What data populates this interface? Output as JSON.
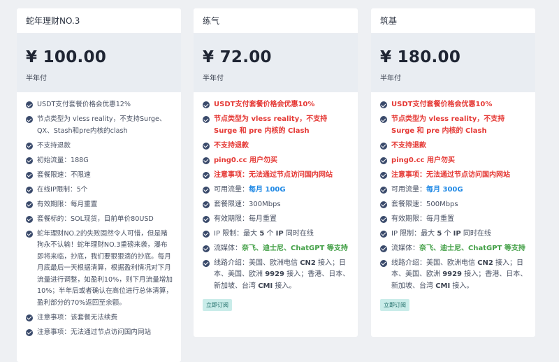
{
  "plans": [
    {
      "name": "蛇年理财NO.3",
      "price": "¥ 100.00",
      "period": "半年付",
      "features": [
        "USDT支付套餐价格会优惠12%",
        "节点类型为 vless reality，不支持Surge、QX、Stash和pre内核的clash",
        "不支持退款",
        "初始流量：188G",
        "套餐限速：不限速",
        "在线IP限制：5个",
        "有效期限：每月重置",
        "套餐标的：SOL现货，目前单价80USD",
        "蛇年理财NO.2的失败固然令人可惜，但是赌狗永不认输！蛇年理财NO.3重磅来袭，瀑布即将来临，抄底，我们要狠狠滴的抄底。每月月底最后一天根据清算，根据盈利情况对下月流量进行调整，如盈利10%，则下月流量增加10%；半年后或者确认在高位进行总体清算，盈利部分的70%返回至余额。",
        "注意事项：该套餐无法续费",
        "注意事项：无法通过节点访问国内网站"
      ]
    },
    {
      "name": "练气",
      "price": "¥ 72.00",
      "period": "半年付",
      "f_usdt": "USDT支付套餐价格会优惠10%",
      "f_node": "节点类型为 vless reality，不支持 Surge 和 pre 内核的 Clash",
      "f_refund": "不支持退款",
      "f_ping": "ping0.cc 用户勿买",
      "f_notice": "注意事项：无法通过节点访问国内网站",
      "traffic_label": "可用流量：",
      "traffic_value": "每月 100G",
      "speed": "套餐限速：300Mbps",
      "validity": "有效期限：每月重置",
      "ip_pre": "IP 限制：最大 ",
      "ip_num": "5",
      "ip_mid": " 个 ",
      "ip_ip": "IP",
      "ip_post": " 同时在线",
      "media_label": "流媒体：",
      "media_value": "奈飞、迪士尼、ChatGPT 等支持",
      "route_pre": "线路介绍：美国、欧洲电信 ",
      "route_cn2": "CN2",
      "route_mid": " 接入；日本、美国、欧洲 ",
      "route_9929": "9929",
      "route_mid2": " 接入；香港、日本、新加坡、台湾 ",
      "route_cmi": "CMI",
      "route_post": " 接入。",
      "order_label": "立即订阅"
    },
    {
      "name": "筑基",
      "price": "¥ 180.00",
      "period": "半年付",
      "f_usdt": "USDT支付套餐价格会优惠10%",
      "f_node": "节点类型为 vless reality，不支持 Surge 和 pre 内核的 Clash",
      "f_refund": "不支持退款",
      "f_ping": "ping0.cc 用户勿买",
      "f_notice": "注意事项：无法通过节点访问国内网站",
      "traffic_label": "可用流量：",
      "traffic_value": "每月 300G",
      "speed": "套餐限速：500Mbps",
      "validity": "有效期限：每月重置",
      "ip_pre": "IP 限制：最大 ",
      "ip_num": "5",
      "ip_mid": " 个 ",
      "ip_ip": "IP",
      "ip_post": " 同时在线",
      "media_label": "流媒体：",
      "media_value": "奈飞、迪士尼、ChatGPT 等支持",
      "route_pre": "线路介绍：美国、欧洲电信 ",
      "route_cn2": "CN2",
      "route_mid": " 接入；日本、美国、欧洲 ",
      "route_9929": "9929",
      "route_mid2": " 接入；香港、日本、新加坡、台湾 ",
      "route_cmi": "CMI",
      "route_post": " 接入。",
      "order_label": "立即订阅"
    }
  ],
  "colors": {
    "background": "#eef0f3",
    "price_box": "#e9edf2",
    "check_icon": "#3a4a6b",
    "highlight_red": "#e53935",
    "highlight_blue": "#1e88e5",
    "highlight_green": "#43a047",
    "order_button_bg": "#c9ece9"
  }
}
